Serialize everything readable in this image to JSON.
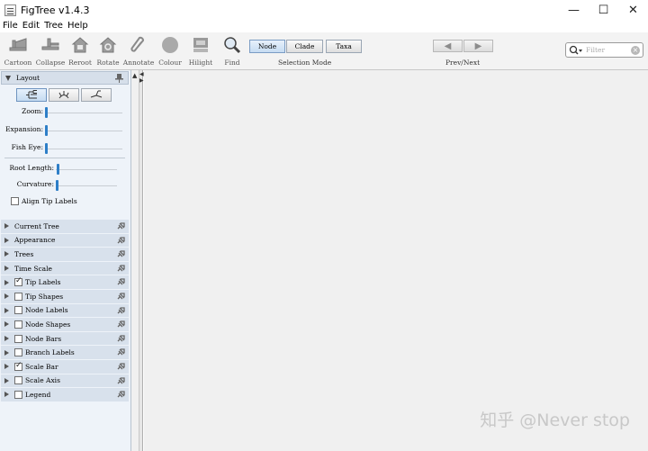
{
  "window": {
    "title": "FigTree v1.4.3",
    "controls": {
      "minimize": "—",
      "maximize": "☐",
      "close": "✕"
    }
  },
  "menu": [
    "File",
    "Edit",
    "Tree",
    "Help"
  ],
  "toolbar": {
    "tools": [
      {
        "label": "Cartoon",
        "icon": "cartoon-icon"
      },
      {
        "label": "Collapse",
        "icon": "collapse-icon"
      },
      {
        "label": "Reroot",
        "icon": "reroot-icon"
      },
      {
        "label": "Rotate",
        "icon": "rotate-icon"
      },
      {
        "label": "Annotate",
        "icon": "annotate-icon"
      },
      {
        "label": "Colour",
        "icon": "colour-icon"
      },
      {
        "label": "Hilight",
        "icon": "hilight-icon"
      },
      {
        "label": "Find",
        "icon": "find-icon"
      }
    ],
    "selection_mode": {
      "label": "Selection Mode",
      "options": [
        "Node",
        "Clade",
        "Taxa"
      ],
      "selected": "Node"
    },
    "prev_next": {
      "label": "Prev/Next",
      "prev": "◀",
      "next": "▶"
    },
    "filter": {
      "placeholder": "Filter"
    }
  },
  "layout_panel": {
    "header": "Layout",
    "layout_types": [
      "rectangular",
      "polar",
      "radial"
    ],
    "selected_layout": "rectangular",
    "sliders": [
      {
        "label": "Zoom:",
        "value": 0
      },
      {
        "label": "Expansion:",
        "value": 0
      },
      {
        "label": "Fish Eye:",
        "value": 0
      },
      {
        "label": "Root Length:",
        "value": 0.02
      },
      {
        "label": "Curvature:",
        "value": 0
      }
    ],
    "align_tip_labels": {
      "label": "Align Tip Labels",
      "checked": false
    }
  },
  "sections": [
    {
      "label": "Current Tree",
      "checkbox": null
    },
    {
      "label": "Appearance",
      "checkbox": null
    },
    {
      "label": "Trees",
      "checkbox": null
    },
    {
      "label": "Time Scale",
      "checkbox": null
    },
    {
      "label": "Tip Labels",
      "checkbox": true
    },
    {
      "label": "Tip Shapes",
      "checkbox": false
    },
    {
      "label": "Node Labels",
      "checkbox": false
    },
    {
      "label": "Node Shapes",
      "checkbox": false
    },
    {
      "label": "Node Bars",
      "checkbox": false
    },
    {
      "label": "Branch Labels",
      "checkbox": false
    },
    {
      "label": "Scale Bar",
      "checkbox": true
    },
    {
      "label": "Scale Axis",
      "checkbox": false
    },
    {
      "label": "Legend",
      "checkbox": false
    }
  ],
  "watermark": "知乎 @Never stop"
}
